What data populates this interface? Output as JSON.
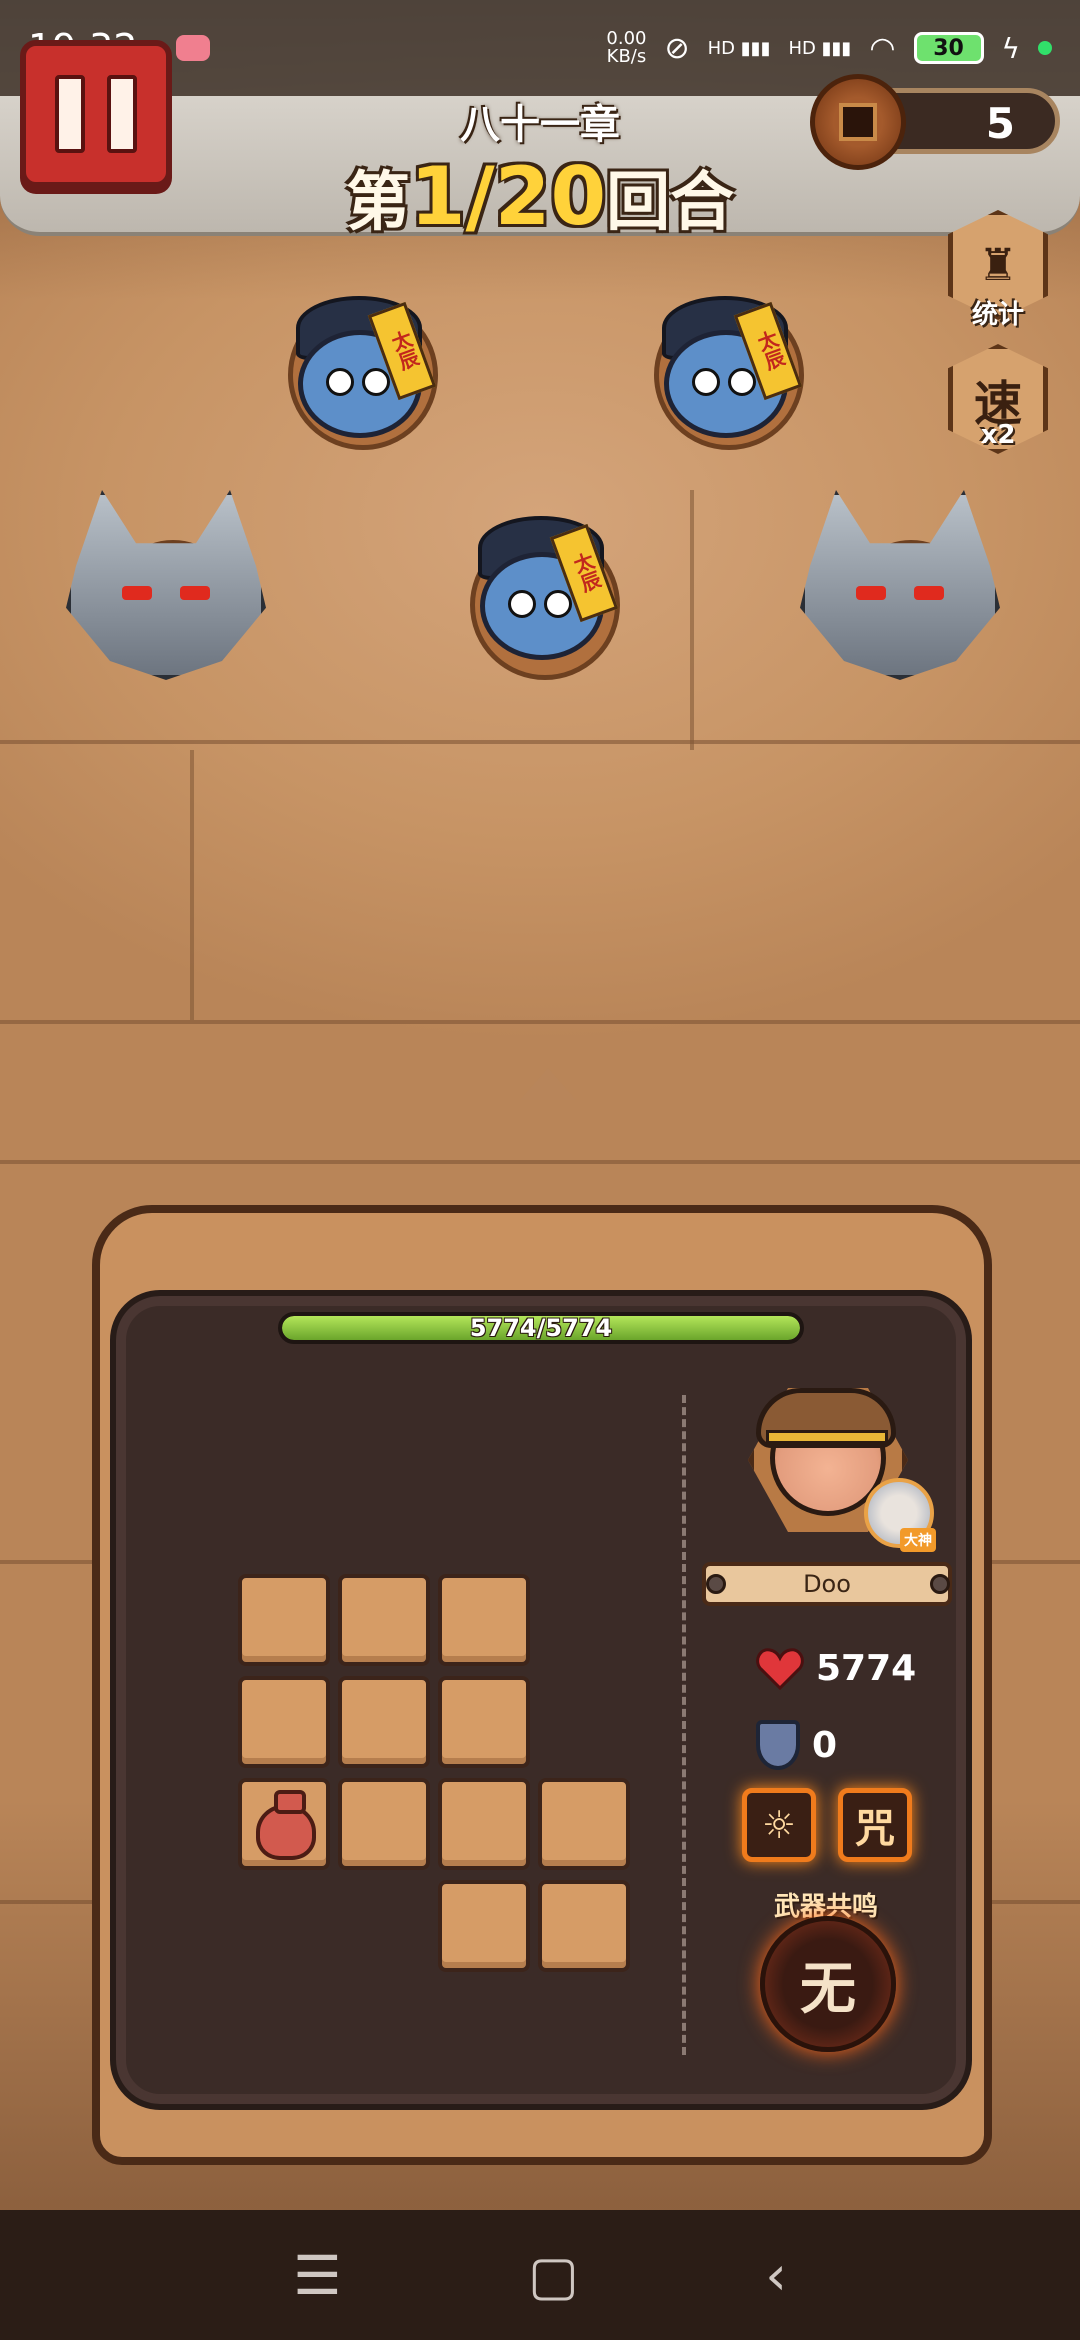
{
  "status_bar": {
    "time": "19:32",
    "net_speed_value": "0.00",
    "net_speed_unit": "KB/s",
    "sig1": "HD",
    "sig2": "HD",
    "battery": "30"
  },
  "header": {
    "chapter": "八十一章",
    "round_prefix": "第",
    "round_value": "1/20",
    "round_suffix": "回合",
    "coins": "5"
  },
  "side_buttons": {
    "stats_label": "统计",
    "speed_glyph": "速",
    "speed_label": "x2"
  },
  "enemies": [
    {
      "type": "jiangshi",
      "talisman": "太辰"
    },
    {
      "type": "jiangshi",
      "talisman": "太辰"
    },
    {
      "type": "jiangshi",
      "talisman": "太辰"
    },
    {
      "type": "wolf"
    },
    {
      "type": "wolf"
    }
  ],
  "panel": {
    "hp_text": "5774/5774",
    "hp_fraction": 1.0,
    "hero_name": "Doo",
    "partner_tag": "大神",
    "health": "5774",
    "armor": "0",
    "skill2_glyph": "咒",
    "weapon_resonance_label": "武器共鸣",
    "weapon_resonance_value": "无"
  },
  "nav": {
    "menu": "☰",
    "home": "▢",
    "back": "‹"
  },
  "colors": {
    "pause": "#c8302c",
    "hp": "#8ac43a",
    "accent": "#f07b1c"
  }
}
